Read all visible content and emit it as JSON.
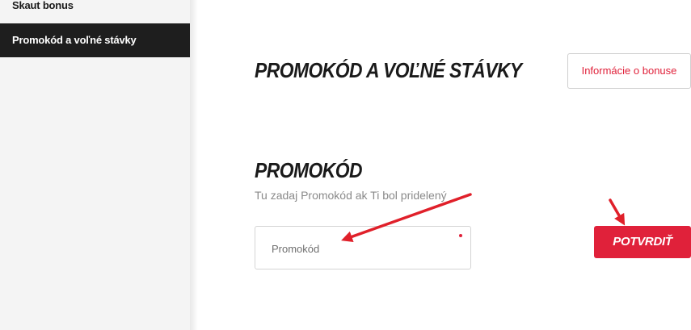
{
  "sidebar": {
    "items": [
      {
        "label": "Skaut bonus",
        "active": false
      },
      {
        "label": "Promokód a voľné stávky",
        "active": true
      }
    ]
  },
  "main": {
    "title": "PROMOKÓD A VOĽNÉ STÁVKY",
    "info_button_label": "Informácie o bonuse",
    "promo_section": {
      "title": "PROMOKÓD",
      "subtitle": "Tu zadaj Promokód ak Ti bol pridelený",
      "input_placeholder": "Promokód",
      "input_value": "",
      "confirm_label": "POTVRDIŤ"
    }
  },
  "colors": {
    "accent": "#e0213a",
    "sidebar_active_bg": "#1e1e1e",
    "sidebar_bg": "#f4f4f4",
    "arrow": "#e0202a"
  },
  "icons": {
    "annotation": "arrow-icon",
    "required_indicator": "required-dot-icon"
  }
}
